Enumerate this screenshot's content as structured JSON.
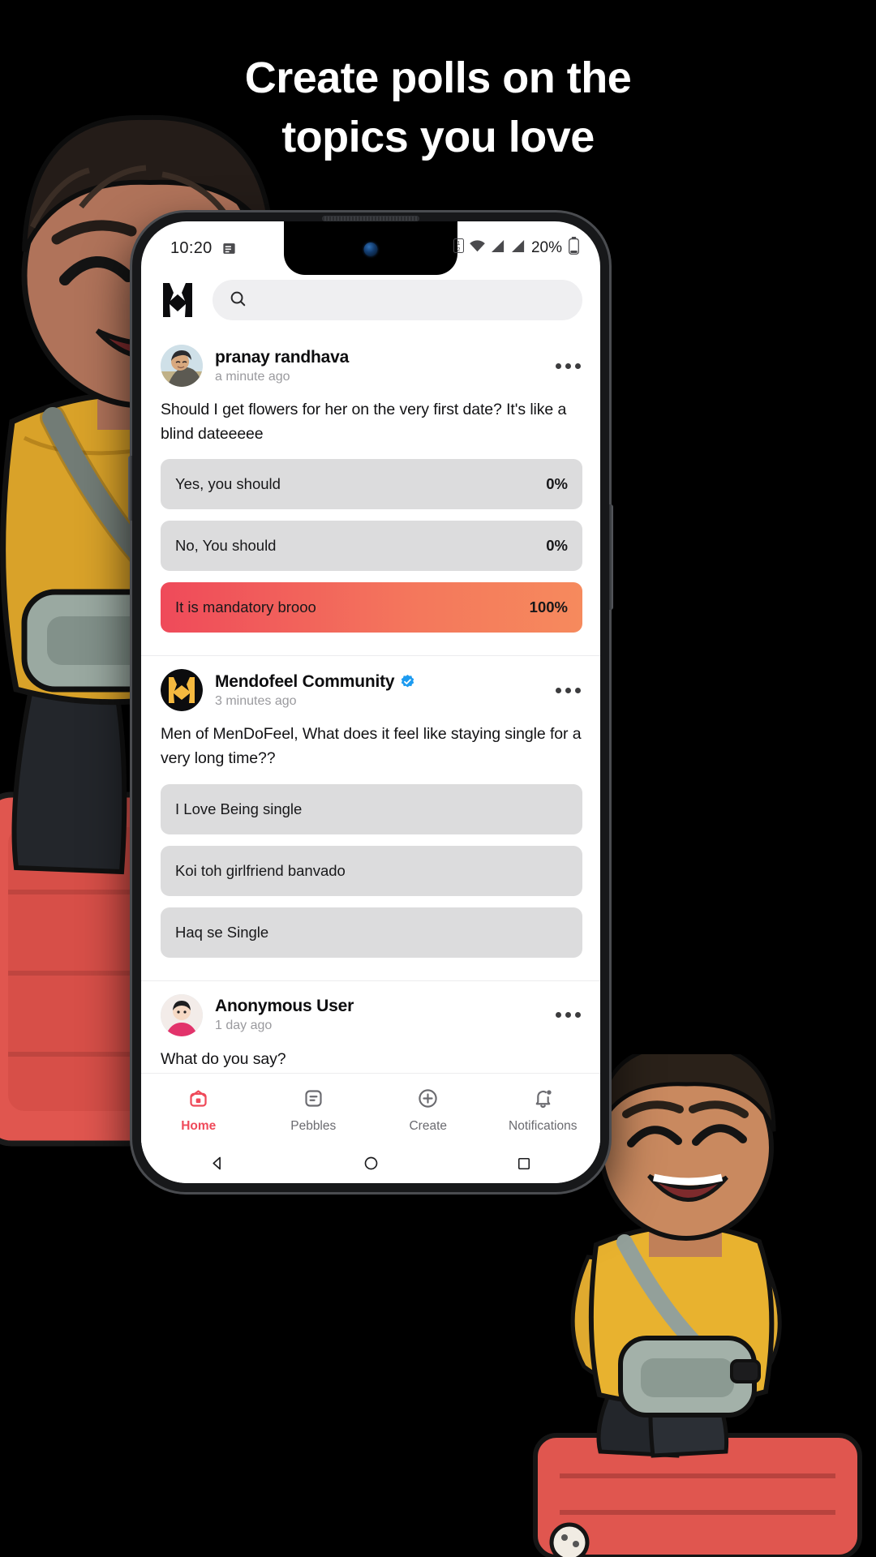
{
  "headline": {
    "line1": "Create polls on the",
    "line2": "topics you love"
  },
  "statusbar": {
    "time": "10:20",
    "news_icon": "news-icon",
    "sim_icon": "sim-card-icon",
    "wifi_icon": "wifi-icon",
    "signal_icon": "cellular-signal-icon",
    "battery_percent": "20%",
    "battery_icon": "battery-icon"
  },
  "header": {
    "logo_icon": "mendofeel-logo-icon",
    "search_icon": "search-icon",
    "search_value": "",
    "search_placeholder": ""
  },
  "posts": [
    {
      "username": "pranay randhava",
      "verified": false,
      "time": "a minute ago",
      "text": "Should I get flowers for her on the very first date? It's like a blind dateeeee",
      "menu_icon": "more-options-icon",
      "options": [
        {
          "label": "Yes, you should",
          "percent": "0%",
          "value": 0,
          "selected": false
        },
        {
          "label": "No, You should",
          "percent": "0%",
          "value": 0,
          "selected": false
        },
        {
          "label": "It is mandatory brooo",
          "percent": "100%",
          "value": 100,
          "selected": true
        }
      ]
    },
    {
      "username": "Mendofeel Community",
      "verified": true,
      "time": "3 minutes ago",
      "text": "Men of MenDoFeel, What does it feel like staying single for a very long time??",
      "menu_icon": "more-options-icon",
      "options": [
        {
          "label": "I Love Being single",
          "percent": "",
          "value": 0,
          "selected": false
        },
        {
          "label": "Koi toh girlfriend banvado",
          "percent": "",
          "value": 0,
          "selected": false
        },
        {
          "label": "Haq se Single",
          "percent": "",
          "value": 0,
          "selected": false
        }
      ]
    },
    {
      "username": "Anonymous User",
      "verified": false,
      "time": "1 day ago",
      "text": "What do you say?",
      "menu_icon": "more-options-icon",
      "options": []
    }
  ],
  "bottom_nav": [
    {
      "label": "Home",
      "icon": "home-icon",
      "active": true
    },
    {
      "label": "Pebbles",
      "icon": "pebbles-icon",
      "active": false
    },
    {
      "label": "Create",
      "icon": "create-plus-icon",
      "active": false
    },
    {
      "label": "Notifications",
      "icon": "notifications-icon",
      "active": false
    }
  ],
  "android_nav": [
    {
      "icon": "back-triangle-icon"
    },
    {
      "icon": "home-circle-icon"
    },
    {
      "icon": "recents-square-icon"
    }
  ],
  "colors": {
    "accent_start": "#ef4a5a",
    "accent_end": "#f68a5d",
    "option_bg": "#dcdcdd",
    "verified_blue": "#1d9bf0",
    "brand_yellow": "#f5b93f",
    "background": "#000000"
  }
}
